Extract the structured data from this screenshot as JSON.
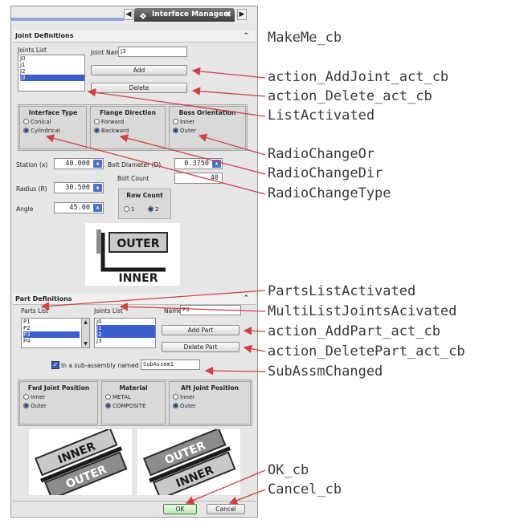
{
  "window": {
    "title": "Interface Manager"
  },
  "joint_panel": {
    "header": "Joint Definitions",
    "joints_list_label": "Joints List",
    "joints": [
      "J0",
      "J1",
      "J2",
      "J3"
    ],
    "selected_joint": "J3",
    "joint_name_label": "Joint Name",
    "joint_name_value": "J3",
    "add_label": "Add",
    "delete_label": "Delete",
    "interface_type": {
      "title": "Interface Type",
      "options": [
        "Conical",
        "Cylindrical"
      ],
      "selected": "Cylindrical"
    },
    "flange_direction": {
      "title": "Flange Direction",
      "options": [
        "Forward",
        "Backward"
      ],
      "selected": "Backward"
    },
    "boss_orientation": {
      "title": "Boss Orientation",
      "options": [
        "Inner",
        "Outer"
      ],
      "selected": "Outer"
    },
    "station_label": "Station (x)",
    "station_value": "40.000",
    "bolt_diameter_label": "Bolt Diameter (D)",
    "bolt_diameter_value": "0.3750",
    "radius_label": "Radius (R)",
    "radius_value": "30.500",
    "bolt_count_label": "Bolt Count",
    "bolt_count_value": "40",
    "angle_label": "Angle",
    "angle_value": "45.00",
    "row_count": {
      "title": "Row Count",
      "options": [
        "1",
        "2"
      ],
      "selected": "2"
    },
    "image_top": "OUTER",
    "image_bottom": "INNER"
  },
  "part_panel": {
    "header": "Part Definitions",
    "parts_list_label": "Parts List",
    "parts": [
      "P1",
      "P2",
      "P3",
      "P4"
    ],
    "selected_part": "P3",
    "joints_list_label": "Joints List",
    "joints": [
      "J0",
      "J1",
      "J2",
      "J3"
    ],
    "selected_joints": [
      "J1",
      "J2"
    ],
    "name_label": "Name",
    "name_value": "P3",
    "add_part_label": "Add Part",
    "delete_part_label": "Delete Part",
    "subassembly_label": "In a sub-assembly named",
    "subassembly_value": "SubAssem1",
    "fwd_joint": {
      "title": "Fwd Joint Position",
      "options": [
        "Inner",
        "Outer"
      ],
      "selected": "Outer"
    },
    "material": {
      "title": "Material",
      "options": [
        "METAL",
        "COMPOSITE"
      ],
      "selected": "COMPOSITE"
    },
    "aft_joint": {
      "title": "Aft Joint Position",
      "options": [
        "Inner",
        "Outer"
      ],
      "selected": "Outer"
    },
    "img1_top": "INNER",
    "img1_bottom": "OUTER",
    "img2_top": "OUTER",
    "img2_bottom": "INNER"
  },
  "footer": {
    "ok_label": "OK",
    "cancel_label": "Cancel"
  },
  "annotations": [
    "MakeMe_cb",
    "action_AddJoint_act_cb",
    "action_Delete_act_cb",
    "ListActivated",
    "RadioChangeOr",
    "RadioChangeDir",
    "RadioChangeType",
    "PartsListActivated",
    "MultiListJointsAcivated",
    "action_AddPart_act_cb",
    "action_DeletePart_act_cb",
    "SubAssmChanged",
    "OK_cb",
    "Cancel_cb"
  ],
  "colors": {
    "arrow": "#d04040",
    "selection": "#3a5fcd",
    "ok_green": "#4caf50"
  }
}
